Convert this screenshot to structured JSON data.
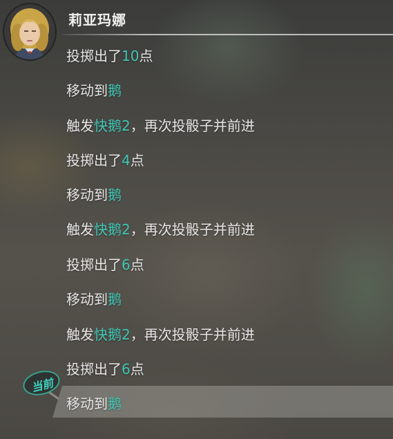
{
  "player": {
    "name": "莉亚玛娜",
    "avatar_icon": "character-portrait-icon"
  },
  "colors": {
    "highlight": "#3fc7b5",
    "text": "#e6e6e6"
  },
  "log": [
    {
      "text": "投掷出了",
      "value": "10",
      "suffix": "点"
    },
    {
      "text": "移动到",
      "location": "鹅"
    },
    {
      "text": "触发",
      "event": "快鹅2",
      "suffix": "，再次投骰子并前进"
    },
    {
      "text": "投掷出了",
      "value": "4",
      "suffix": "点"
    },
    {
      "text": "移动到",
      "location": "鹅"
    },
    {
      "text": "触发",
      "event": "快鹅2",
      "suffix": "，再次投骰子并前进"
    },
    {
      "text": "投掷出了",
      "value": "6",
      "suffix": "点"
    },
    {
      "text": "移动到",
      "location": "鹅"
    },
    {
      "text": "触发",
      "event": "快鹅2",
      "suffix": "，再次投骰子并前进"
    },
    {
      "text": "投掷出了",
      "value": "6",
      "suffix": "点"
    },
    {
      "text": "移动到",
      "location": "鹅"
    }
  ],
  "current_badge": {
    "label": "当前"
  }
}
